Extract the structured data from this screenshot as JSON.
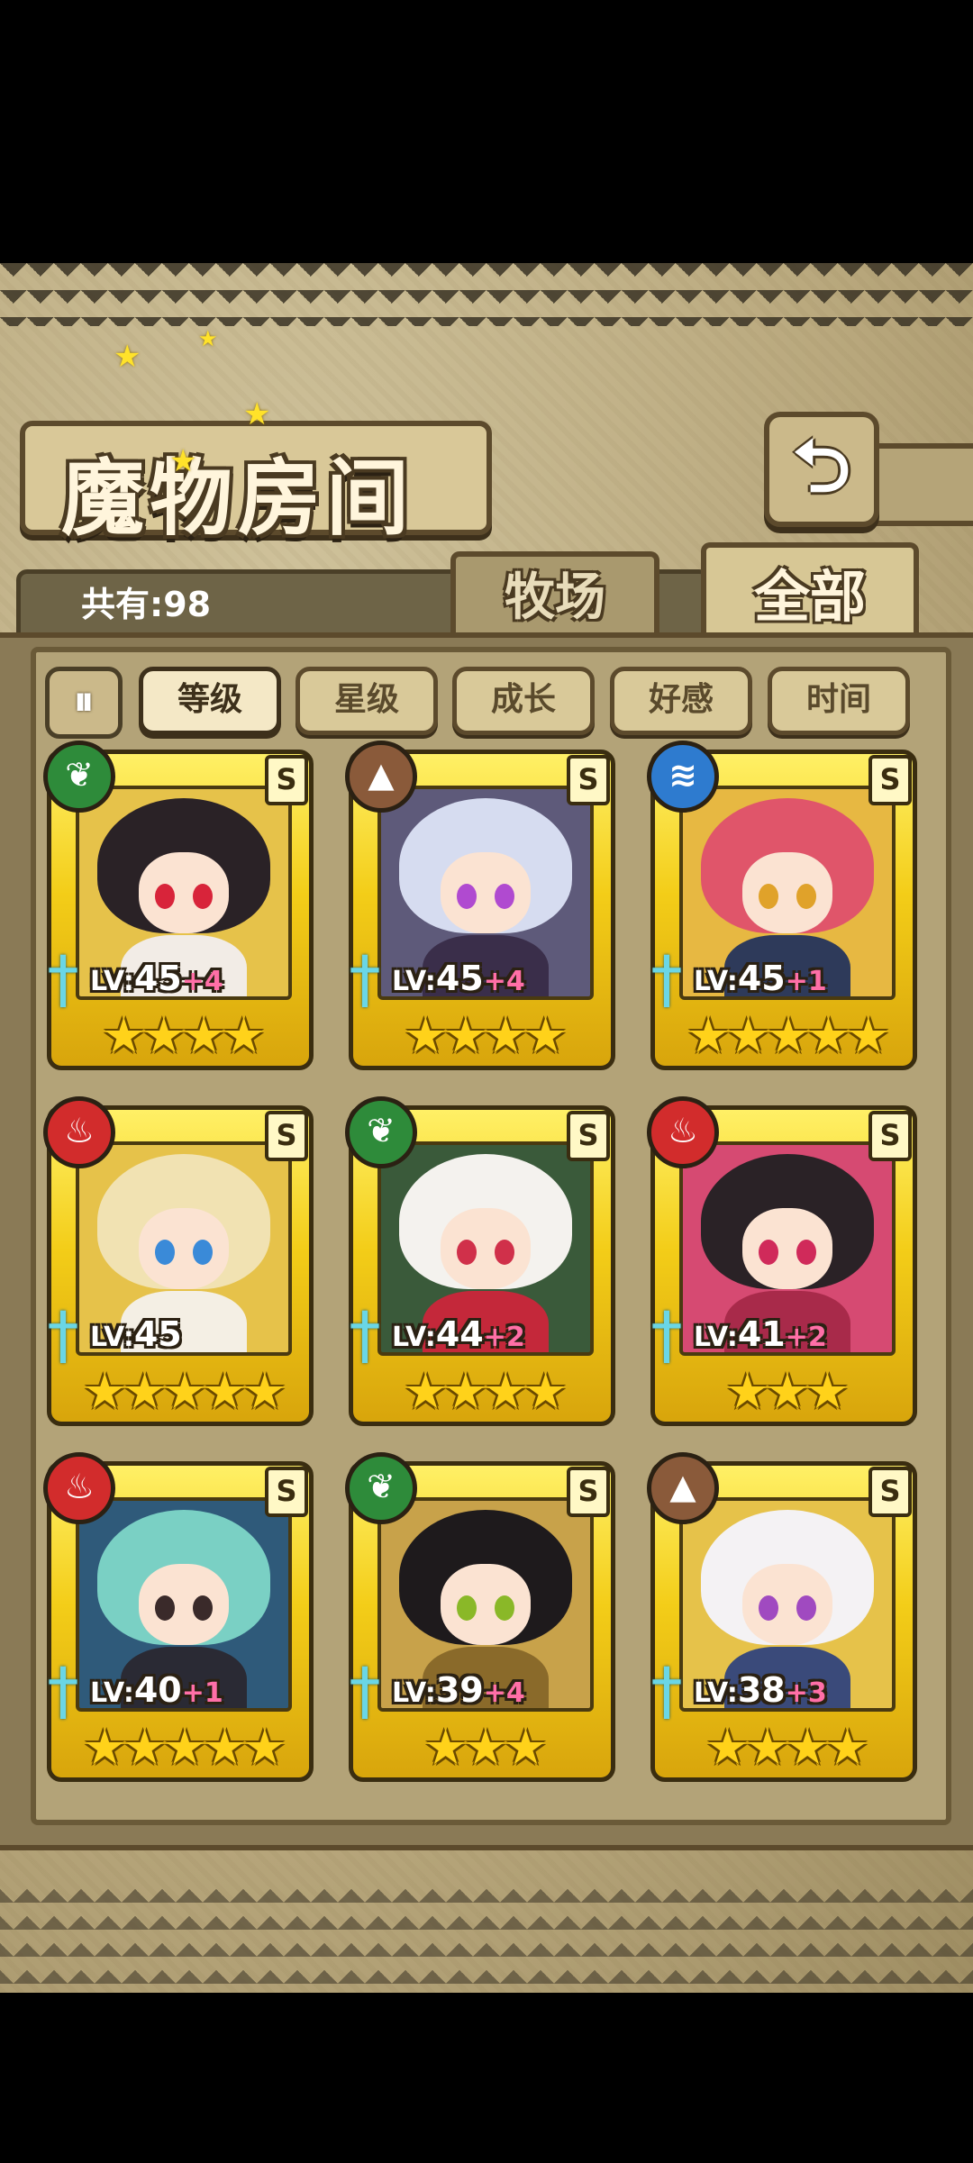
{
  "title": "魔物房间",
  "back_icon": "⮌",
  "count_label": "共有:98",
  "tabs": [
    {
      "label": "牧场",
      "active": false
    },
    {
      "label": "全部",
      "active": true
    }
  ],
  "sort_toggle_icon": "⏸",
  "sort_buttons": [
    {
      "label": "等级",
      "active": true
    },
    {
      "label": "星级",
      "active": false
    },
    {
      "label": "成长",
      "active": false
    },
    {
      "label": "好感",
      "active": false
    },
    {
      "label": "时间",
      "active": false
    }
  ],
  "monsters": [
    {
      "element": "nature",
      "element_icon": "❦",
      "rank": "S",
      "level_label": "LV:",
      "level": "45",
      "plus": "+4",
      "stars": "★★★★",
      "hair": "#2a2226",
      "eye": "#d8243a",
      "outfit": "#f2ece6",
      "bg": "#e6c24a"
    },
    {
      "element": "earth",
      "element_icon": "▲",
      "rank": "S",
      "level_label": "LV:",
      "level": "45",
      "plus": "+4",
      "stars": "★★★★",
      "hair": "#d6dcf0",
      "eye": "#b04ad0",
      "outfit": "#3a2e4a",
      "bg": "#5e5a7a"
    },
    {
      "element": "water",
      "element_icon": "≋",
      "rank": "S",
      "level_label": "LV:",
      "level": "45",
      "plus": "+1",
      "stars": "★★★★★",
      "hair": "#e0556a",
      "eye": "#e0a22a",
      "outfit": "#2e3a5a",
      "bg": "#e7b842"
    },
    {
      "element": "fire",
      "element_icon": "♨",
      "rank": "S",
      "level_label": "LV:",
      "level": "45",
      "plus": "",
      "stars": "★★★★★",
      "hair": "#f1e2b2",
      "eye": "#3a8ad8",
      "outfit": "#f4efe4",
      "bg": "#e6c24a"
    },
    {
      "element": "nature",
      "element_icon": "❦",
      "rank": "S",
      "level_label": "LV:",
      "level": "44",
      "plus": "+2",
      "stars": "★★★★",
      "hair": "#f4f2ee",
      "eye": "#d0304a",
      "outfit": "#c4283a",
      "bg": "#3a5a3a"
    },
    {
      "element": "fire",
      "element_icon": "♨",
      "rank": "S",
      "level_label": "LV:",
      "level": "41",
      "plus": "+2",
      "stars": "★★★",
      "hair": "#2a2226",
      "eye": "#d02a5a",
      "outfit": "#a82a4a",
      "bg": "#d64a72"
    },
    {
      "element": "fire",
      "element_icon": "♨",
      "rank": "S",
      "level_label": "LV:",
      "level": "40",
      "plus": "+1",
      "stars": "★★★★★",
      "hair": "#7ad0c4",
      "eye": "#3a2a2a",
      "outfit": "#2a2a34",
      "bg": "#2f5a7a"
    },
    {
      "element": "nature",
      "element_icon": "❦",
      "rank": "S",
      "level_label": "LV:",
      "level": "39",
      "plus": "+4",
      "stars": "★★★",
      "hair": "#1e1a1c",
      "eye": "#8ab828",
      "outfit": "#8a6a2a",
      "bg": "#c8a24a"
    },
    {
      "element": "earth",
      "element_icon": "▲",
      "rank": "S",
      "level_label": "LV:",
      "level": "38",
      "plus": "+3",
      "stars": "★★★★",
      "hair": "#f4f2f4",
      "eye": "#a04ac0",
      "outfit": "#3a4a7a",
      "bg": "#e6c24a"
    }
  ]
}
